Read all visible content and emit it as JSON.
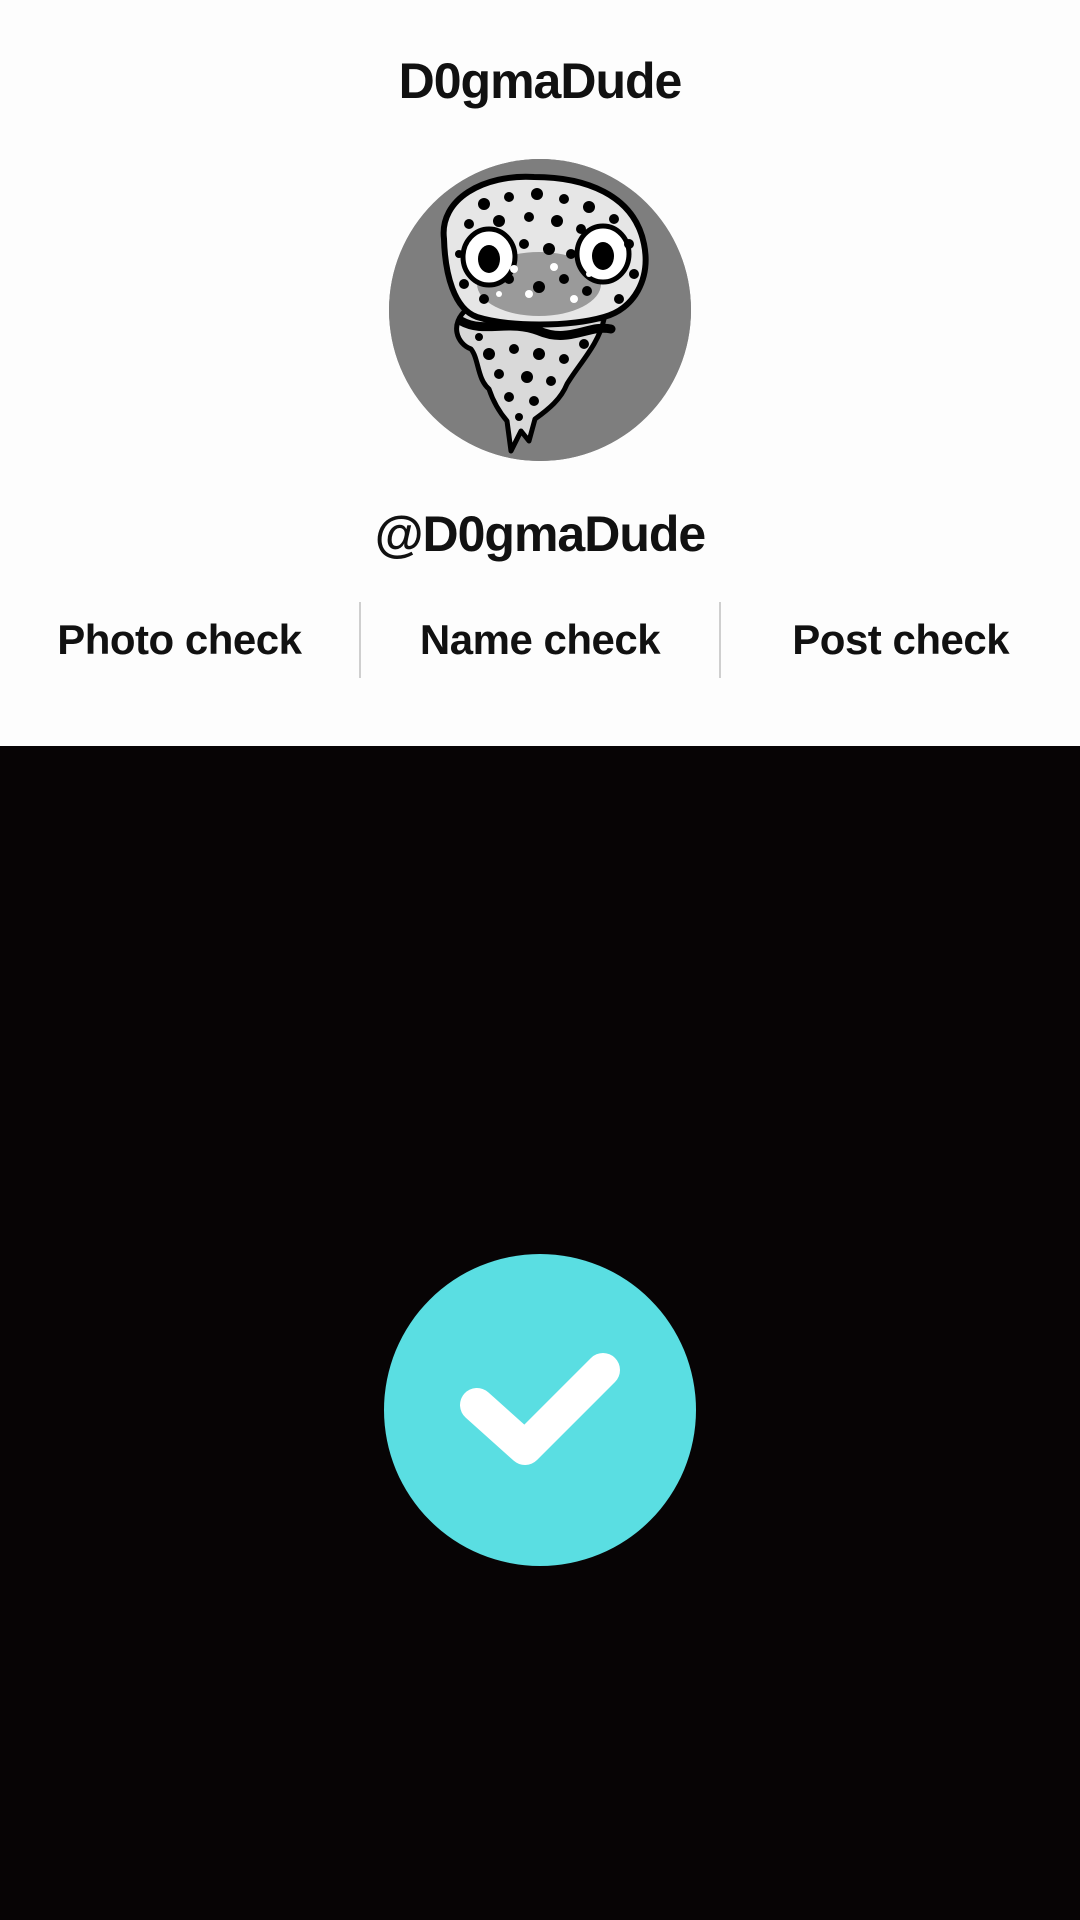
{
  "profile": {
    "display_name": "D0gmaDude",
    "handle": "@D0gmaDude",
    "avatar_icon": "spotted-creature-avatar"
  },
  "checks": {
    "items": [
      {
        "label": "Photo check"
      },
      {
        "label": "Name check"
      },
      {
        "label": "Post check"
      }
    ]
  },
  "status": {
    "icon": "checkmark-icon",
    "accent_color": "#5adee2"
  }
}
